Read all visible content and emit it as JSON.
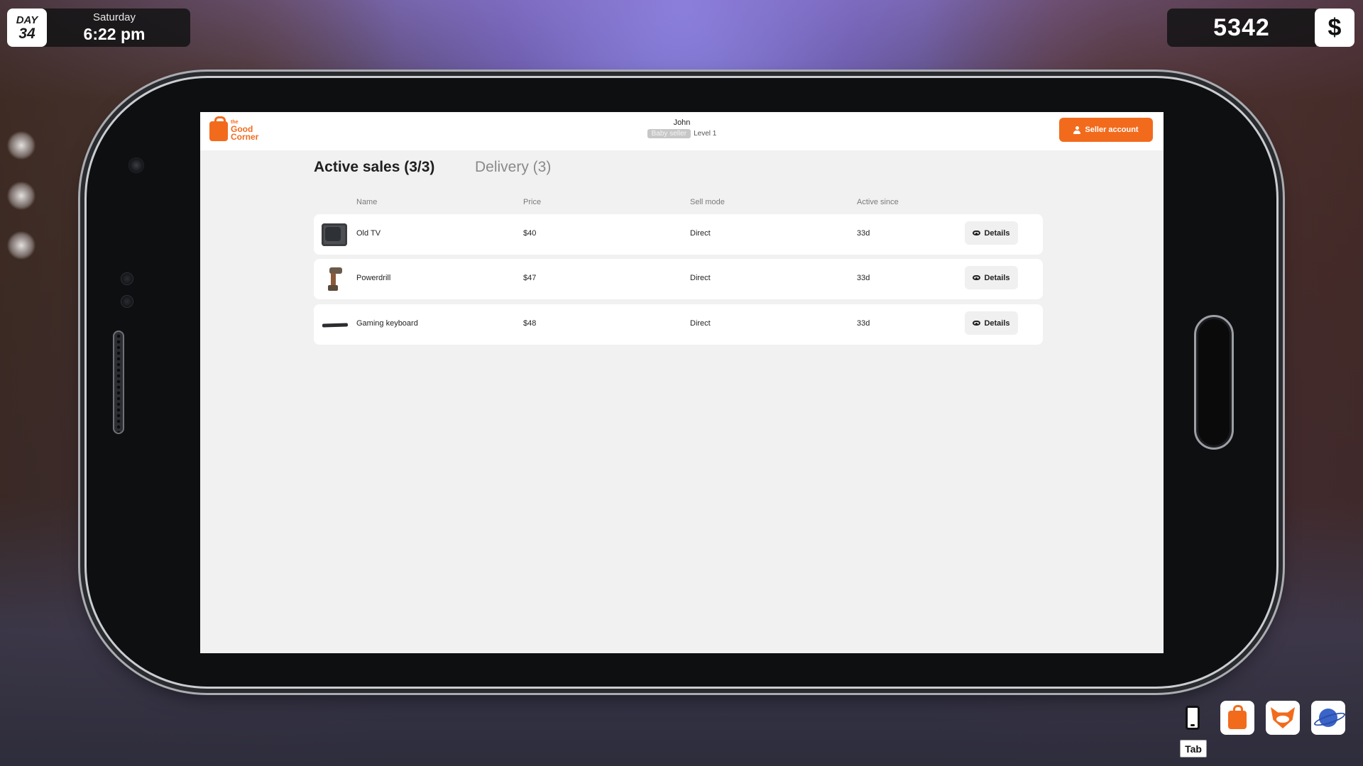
{
  "hud": {
    "day_label": "DAY",
    "day_number": "34",
    "weekday": "Saturday",
    "time": "6:22 pm",
    "money": "5342",
    "currency_symbol": "$"
  },
  "app": {
    "logo": {
      "small": "the",
      "line1": "Good",
      "line2": "Corner"
    },
    "user": {
      "name": "John",
      "badge": "Baby seller",
      "level": "Level 1"
    },
    "seller_button": "Seller account",
    "tabs": [
      {
        "label": "Active sales (3/3)",
        "active": true
      },
      {
        "label": "Delivery (3)",
        "active": false
      }
    ],
    "columns": {
      "name": "Name",
      "price": "Price",
      "sell_mode": "Sell mode",
      "active_since": "Active since"
    },
    "sales": [
      {
        "name": "Old TV",
        "price": "$40",
        "sell_mode": "Direct",
        "active_since": "33d",
        "action": "Details",
        "thumb": "tv-thumbnail"
      },
      {
        "name": "Powerdrill",
        "price": "$47",
        "sell_mode": "Direct",
        "active_since": "33d",
        "action": "Details",
        "thumb": "drill-thumbnail"
      },
      {
        "name": "Gaming keyboard",
        "price": "$48",
        "sell_mode": "Direct",
        "active_since": "33d",
        "action": "Details",
        "thumb": "keyboard-thumbnail"
      }
    ]
  },
  "dock": {
    "items": [
      "phone-icon",
      "good-corner-bag-icon",
      "fox-icon",
      "planet-icon"
    ],
    "tab_key": "Tab"
  },
  "colors": {
    "accent": "#f26b1d",
    "screen_bg": "#f1f1f1",
    "hud_bg": "#141416"
  }
}
